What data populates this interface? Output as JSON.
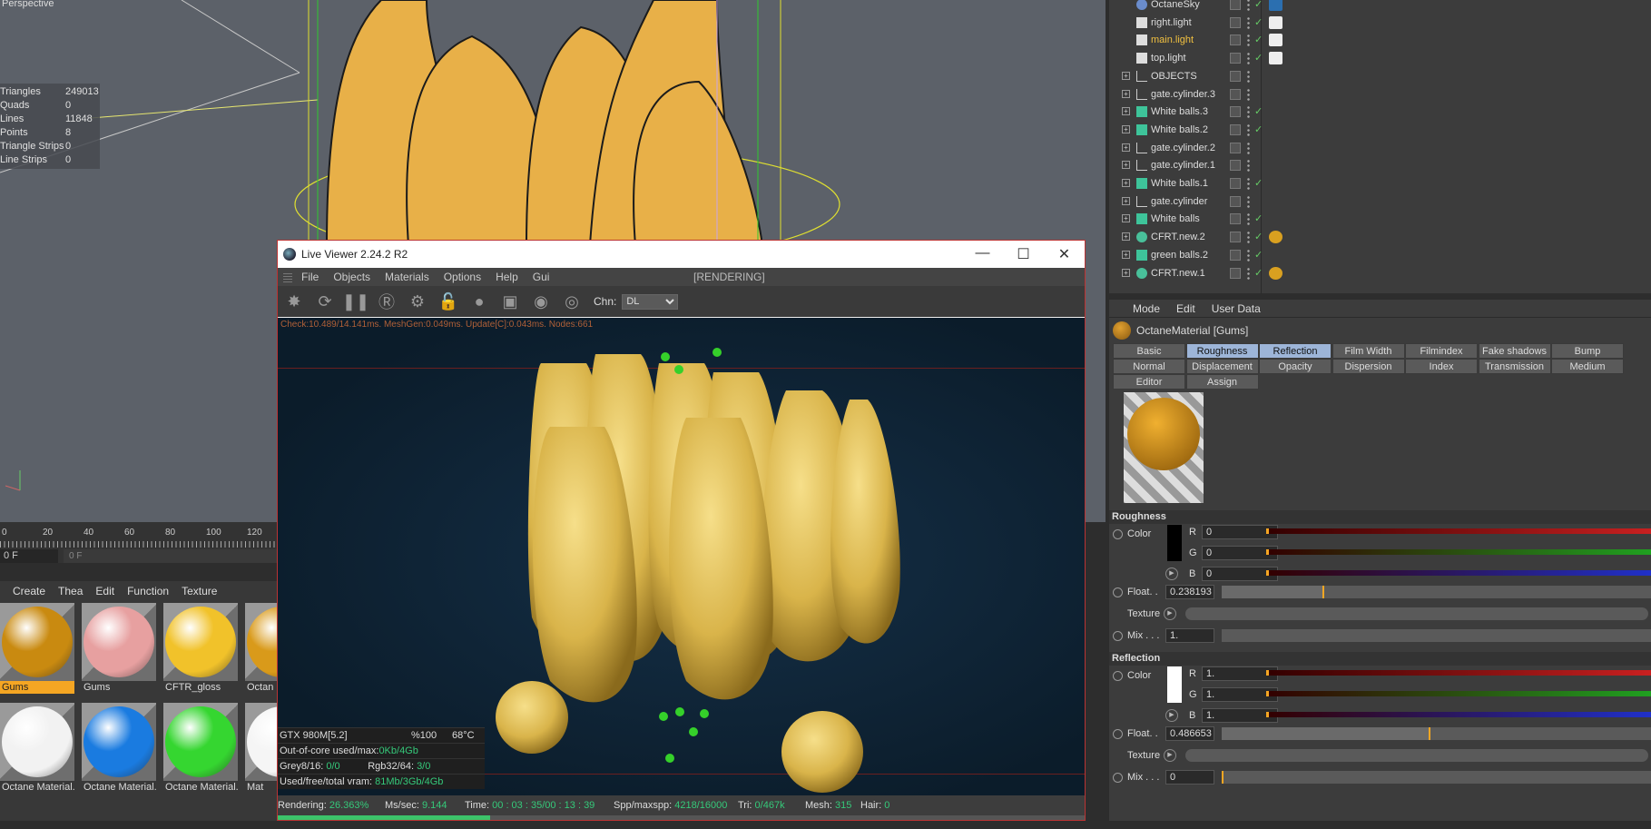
{
  "viewport": {
    "label": "Perspective",
    "stats": [
      {
        "k": "Triangles",
        "v": "249013"
      },
      {
        "k": "Quads",
        "v": "0"
      },
      {
        "k": "Lines",
        "v": "11848"
      },
      {
        "k": "Points",
        "v": "8"
      },
      {
        "k": "Triangle Strips",
        "v": "0"
      },
      {
        "k": "Line Strips",
        "v": "0"
      }
    ]
  },
  "timeline": {
    "ruler": [
      "0",
      "20",
      "40",
      "60",
      "80",
      "100",
      "120"
    ],
    "frame": "0 F",
    "slider": "0 F"
  },
  "materials": {
    "menu": [
      "Create",
      "Thea",
      "Edit",
      "Function",
      "Texture"
    ],
    "items": [
      {
        "name": "Gums",
        "color": "#c98a10",
        "selected": true
      },
      {
        "name": "Gums",
        "color": "#e7a0a0"
      },
      {
        "name": "CFTR_gloss",
        "color": "#f1c22a"
      },
      {
        "name": "Octan",
        "color": "#d99a1a"
      },
      {
        "name": "Octane Material.",
        "color": "#f2f2f2"
      },
      {
        "name": "Octane Material.",
        "color": "#1a7be0"
      },
      {
        "name": "Octane Material.",
        "color": "#35d630"
      },
      {
        "name": "Mat",
        "color": "#f5f5f5"
      }
    ]
  },
  "liveviewer": {
    "title": "Live Viewer 2.24.2 R2",
    "controls": [
      "—",
      "☐",
      "✕"
    ],
    "menu": [
      "File",
      "Objects",
      "Materials",
      "Options",
      "Help",
      "Gui"
    ],
    "status": "[RENDERING]",
    "chn_label": "Chn:",
    "chn_value": "DL",
    "render_info": "Check:10.489/14.141ms. MeshGen:0.049ms. Update[C]:0.043ms. Nodes:661",
    "gpu": {
      "name": "GTX 980M[5.2]",
      "pct": "%100",
      "temp": "68°C",
      "outofcore_label": "Out-of-core used/max:",
      "outofcore": "0Kb/4Gb",
      "grey_label": "Grey8/16:",
      "grey": "0/0",
      "rgb_label": "Rgb32/64:",
      "rgb": "3/0",
      "vram_label": "Used/free/total vram:",
      "vram": "81Mb/3Gb/4Gb"
    },
    "statusbar": {
      "rendering_label": "Rendering:",
      "rendering": "26.363%",
      "ms_label": "Ms/sec:",
      "ms": "9.144",
      "time_label": "Time:",
      "time": "00 : 03 : 35/00 : 13 : 39",
      "spp_label": "Spp/maxspp:",
      "spp": "4218/16000",
      "tri_label": "Tri:",
      "tri": "0/467k",
      "mesh_label": "Mesh:",
      "mesh": "315",
      "hair_label": "Hair:",
      "hair": "0"
    },
    "progress": 0.26363
  },
  "objects": {
    "rows": [
      {
        "name": "OctaneSky",
        "type": "sky"
      },
      {
        "name": "right.light",
        "type": "light"
      },
      {
        "name": "main.light",
        "type": "light",
        "highlight": true
      },
      {
        "name": "top.light",
        "type": "light"
      },
      {
        "name": "OBJECTS",
        "type": "null"
      },
      {
        "name": "gate.cylinder.3",
        "type": "null"
      },
      {
        "name": "White balls.3",
        "type": "cloner"
      },
      {
        "name": "White balls.2",
        "type": "cloner"
      },
      {
        "name": "gate.cylinder.2",
        "type": "null"
      },
      {
        "name": "gate.cylinder.1",
        "type": "null"
      },
      {
        "name": "White balls.1",
        "type": "cloner"
      },
      {
        "name": "gate.cylinder",
        "type": "null"
      },
      {
        "name": "White balls",
        "type": "cloner"
      },
      {
        "name": "CFRT.new.2",
        "type": "mesh"
      },
      {
        "name": "green balls.2",
        "type": "cloner"
      },
      {
        "name": "CFRT.new.1",
        "type": "mesh"
      }
    ]
  },
  "attributes": {
    "menu": [
      "Mode",
      "Edit",
      "User Data"
    ],
    "material_title": "OctaneMaterial [Gums]",
    "tabs": [
      [
        "Basic",
        "Roughness",
        "Reflection",
        "Film Width",
        "Filmindex",
        "Fake shadows",
        "Bump"
      ],
      [
        "Normal",
        "Displacement",
        "Opacity",
        "Dispersion",
        "Index",
        "Transmission",
        "Medium"
      ],
      [
        "Editor",
        "Assign"
      ]
    ],
    "active_tabs": [
      "Roughness",
      "Reflection"
    ],
    "roughness": {
      "title": "Roughness",
      "color_label": "Color",
      "r": "0",
      "g": "0",
      "b": "0",
      "float_label": "Float. .",
      "float": "0.238193",
      "float_fraction": 0.238193,
      "texture_label": "Texture",
      "mix_label": "Mix . . .",
      "mix": "1.",
      "swatch": "#000000"
    },
    "reflection": {
      "title": "Reflection",
      "color_label": "Color",
      "r": "1.",
      "g": "1.",
      "b": "1.",
      "float_label": "Float. .",
      "float": "0.486653",
      "float_fraction": 0.486653,
      "texture_label": "Texture",
      "mix_label": "Mix . . .",
      "mix": "0",
      "swatch": "#ffffff"
    },
    "ch_labels": [
      "R",
      "G",
      "B"
    ]
  }
}
